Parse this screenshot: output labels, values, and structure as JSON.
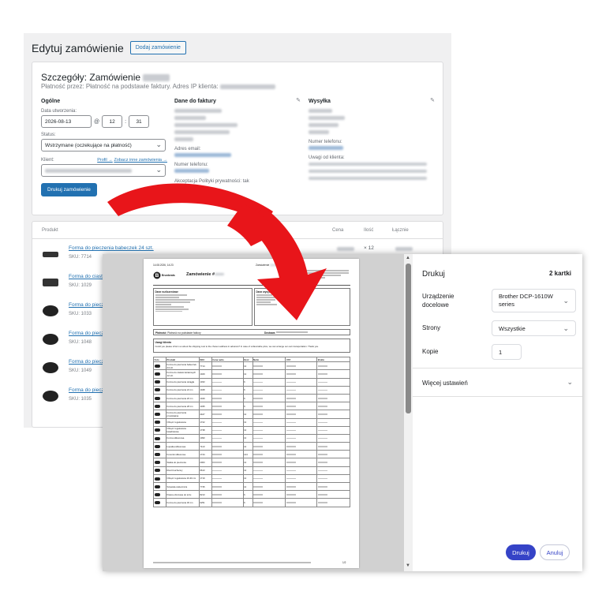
{
  "admin": {
    "page_title": "Edytuj zamówienie",
    "add_order_label": "Dodaj zamówienie",
    "details_title": "Szczegóły: Zamówienie",
    "payment_line": "Płatność przez: Płatność na podstawie faktury. Adres IP klienta:",
    "general": {
      "heading": "Ogólne",
      "date_label": "Data utworzenia:",
      "date_value": "2026-08-13",
      "hour": "12",
      "minute": "31",
      "at_sign": "@",
      "status_label": "Status:",
      "status_value": "Wstrzymane (oczekujące na płatność)",
      "client_label": "Klient:",
      "profile_link": "Profil →",
      "other_orders_link": "Zobacz inne zamówienia →",
      "print_button": "Drukuj zamówienie"
    },
    "billing": {
      "heading": "Dane do faktury",
      "email_label": "Adres email:",
      "phone_label": "Numer telefonu:",
      "privacy_label": "Akceptacja Polityki prywatności: tak"
    },
    "shipping": {
      "heading": "Wysyłka",
      "phone_label": "Numer telefonu:",
      "notes_label": "Uwagi od klienta:"
    },
    "items_header": {
      "product": "Produkt",
      "price": "Cena",
      "qty": "Ilość",
      "total": "Łącznie"
    },
    "first_qty": "× 12",
    "items": [
      {
        "name": "Forma do pieczenia babeczek 24 szt.",
        "sku": "SKU: 7714"
      },
      {
        "name": "Forma do ciast",
        "sku": "SKU: 1029"
      },
      {
        "name": "Forma do piecz",
        "sku": "SKU: 1033"
      },
      {
        "name": "Forma do piecz",
        "sku": "SKU: 1048"
      },
      {
        "name": "Forma do piecz",
        "sku": "SKU: 1049"
      },
      {
        "name": "Forma do piecz",
        "sku": "SKU: 1035"
      }
    ]
  },
  "sheet": {
    "timestamp": "14.08.2026, 14:23",
    "header_title": "Zamówienie",
    "logo_text": "Brunbeats",
    "doc_title": "Zamówienie #",
    "billing_box_title": "Dane rozliczeniowe",
    "shipping_box_title": "Dane wysyłkowe",
    "payment_label": "Płatność:",
    "payment_value": "Płatność na podstawie faktury",
    "shipping_label": "Dostawa:",
    "notes_title": "Uwagi klienta",
    "notes_text": "Could you please inform us about the shipping cost to the chosen address in advance? In case of unfavorable price, we can arrange our own transportation. Thank you.",
    "table_headers": [
      "Foto",
      "Produkt",
      "SKU",
      "Cena netto",
      "Ilość",
      "Netto",
      "VAT",
      "Brutto"
    ],
    "rows": [
      {
        "name": "Forma do pieczenia babeczek 24 szt.",
        "sku": "7714",
        "qty": "12"
      },
      {
        "name": "Forma do ciastek kwiatowych 12 szt.",
        "sku": "1029",
        "qty": "12"
      },
      {
        "name": "Forma do pieczenia okrągła",
        "sku": "1033",
        "qty": "6"
      },
      {
        "name": "Forma do pieczenia 24 cm",
        "sku": "1048",
        "qty": "6"
      },
      {
        "name": "Forma do pieczenia 26 cm",
        "sku": "1049",
        "qty": "6"
      },
      {
        "name": "Forma do pieczenia 28 cm",
        "sku": "1035",
        "qty": "6"
      },
      {
        "name": "Forma do pieczenia prostokątna",
        "sku": "4427",
        "qty": "12"
      },
      {
        "name": "Obręcz regulowana",
        "sku": "1722",
        "qty": "12"
      },
      {
        "name": "Obręcz regulowana kwadratowa",
        "sku": "1738",
        "qty": "12"
      },
      {
        "name": "Forma silikonowa",
        "sku": "1090",
        "qty": "12"
      },
      {
        "name": "Łopatka silikonowa",
        "sku": "7110",
        "qty": "12"
      },
      {
        "name": "Foremki silikonowe",
        "sku": "1744",
        "qty": "144"
      },
      {
        "name": "Siatka do pieczenia",
        "sku": "2063",
        "qty": "12"
      },
      {
        "name": "Ruszt kuchenny",
        "sku": "6613",
        "qty": "12"
      },
      {
        "name": "Obręcz regulowana 16-30 cm",
        "sku": "1719",
        "qty": "12"
      },
      {
        "name": "Szpatuła cukiernicza",
        "sku": "7735",
        "qty": "12"
      },
      {
        "name": "Patera obrotowa do tortu",
        "sku": "8213",
        "qty": "6"
      },
      {
        "name": "Forma do pieczenia 30 cm",
        "sku": "6251",
        "qty": "6"
      }
    ],
    "page_num": "1/2"
  },
  "print": {
    "title": "Drukuj",
    "sheets": "2 kartki",
    "destination_label": "Urządzenie docelowe",
    "destination_value": "Brother DCP-1610W series",
    "pages_label": "Strony",
    "pages_value": "Wszystkie",
    "copies_label": "Kopie",
    "copies_value": "1",
    "more_settings": "Więcej ustawień",
    "print_button": "Drukuj",
    "cancel_button": "Anuluj"
  },
  "colors": {
    "admin_accent": "#2271b1",
    "arrow": "#e8151a",
    "print_button": "#3543c7"
  },
  "icons": [
    "pencil-icon",
    "chevron-down-icon",
    "red-arrow-icon"
  ]
}
